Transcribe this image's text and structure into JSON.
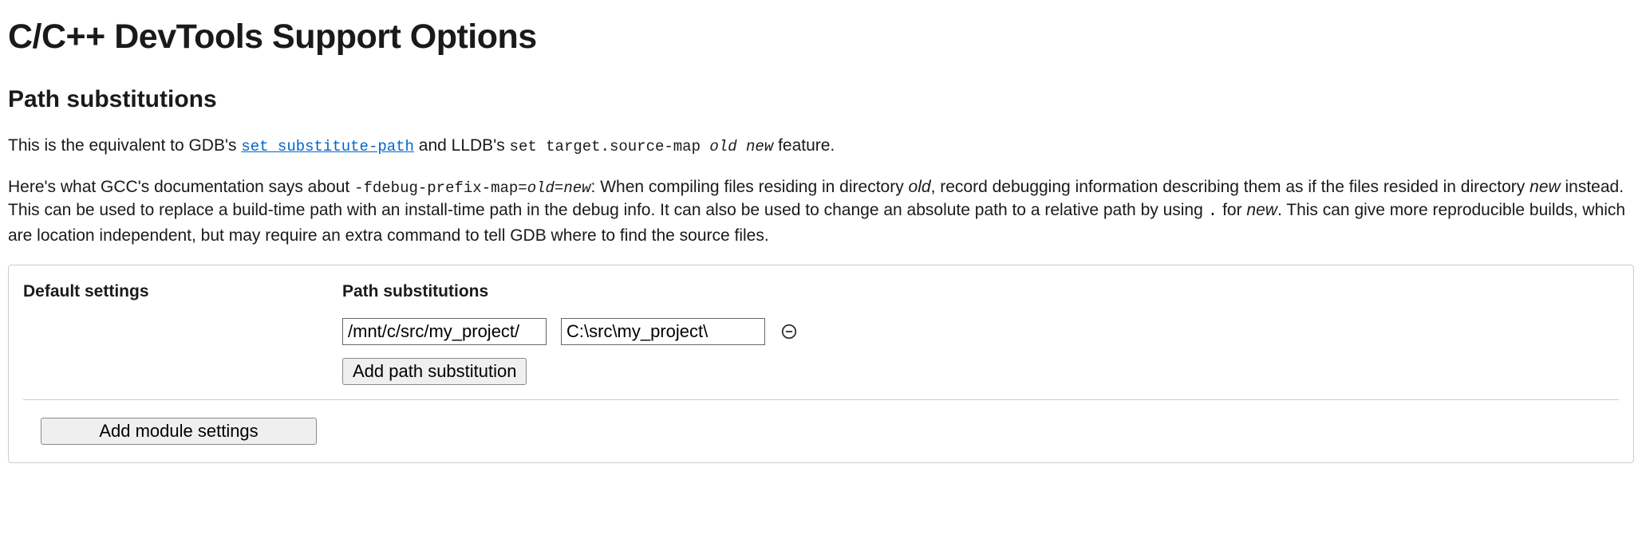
{
  "title": "C/C++ DevTools Support Options",
  "section_heading": "Path substitutions",
  "intro": {
    "prefix": "This is the equivalent to GDB's ",
    "link_text": "set substitute-path",
    "mid": " and LLDB's ",
    "lldb_cmd": "set target.source-map ",
    "lldb_old": "old",
    "lldb_space": " ",
    "lldb_new": "new",
    "suffix": " feature."
  },
  "detail": {
    "p1": "Here's what GCC's documentation says about ",
    "flag": "-fdebug-prefix-map=",
    "flag_old": "old",
    "flag_eq": "=",
    "flag_new": "new",
    "p2": ": When compiling files residing in directory ",
    "old_word": "old",
    "p3": ", record debugging information describing them as if the files resided in directory ",
    "new_word": "new",
    "p4": " instead. This can be used to replace a build-time path with an install-time path in the debug info. It can also be used to change an absolute path to a relative path by using ",
    "dot": ".",
    "p5": " for ",
    "new_word2": "new",
    "p6": ". This can give more reproducible builds, which are location independent, but may require an extra command to tell GDB where to find the source files."
  },
  "settings": {
    "default_label": "Default settings",
    "path_sub_label": "Path substitutions",
    "from_value": "/mnt/c/src/my_project/",
    "to_value": "C:\\src\\my_project\\",
    "add_path_btn": "Add path substitution",
    "add_module_btn": "Add module settings"
  }
}
